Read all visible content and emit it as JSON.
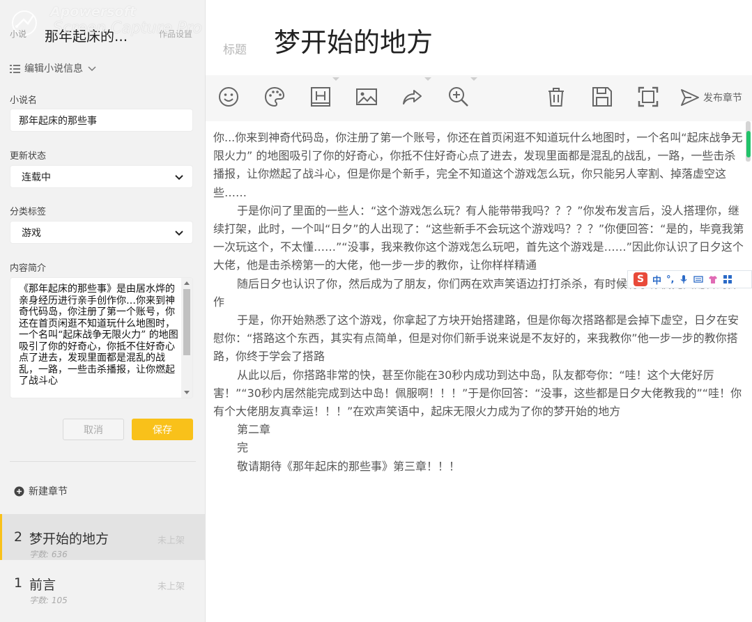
{
  "watermark": {
    "line1": "Apowersoft",
    "line2": "Screen Capture Pro"
  },
  "sidebar": {
    "small_label": "小说",
    "book_title": "那年起床的...",
    "header_right": "作品设置",
    "edit_info_label": "编辑小说信息",
    "novel_name_label": "小说名",
    "novel_name_value": "那年起床的那些事",
    "status_label": "更新状态",
    "status_value": "连载中",
    "category_label": "分类标签",
    "category_value": "游戏",
    "summary_label": "内容简介",
    "summary_value": "《那年起床的那些事》是由居水烨的亲身经历进行亲手创作你…你来到神奇代码岛，你注册了第一个账号，你还在首页闲逛不知道玩什么地图时，一个名叫“起床战争无限火力” 的地图吸引了你的好奇心，你抵不住好奇心点了进去，发现里面都是混乱的战乱，一路，一些击杀播报，让你燃起了战斗心",
    "cancel_label": "取消",
    "save_label": "保存",
    "new_chapter_label": "新建章节",
    "chapters": [
      {
        "num": "2",
        "title": "梦开始的地方",
        "count": "字数: 636",
        "status": "未上架"
      },
      {
        "num": "1",
        "title": "前言",
        "count": "字数: 105",
        "status": "未上架"
      }
    ]
  },
  "editor": {
    "title_label": "标题",
    "title_value": "梦开始的地方",
    "toolbar": {
      "icons": [
        "emoji-icon",
        "palette-icon",
        "heading-icon",
        "image-icon",
        "share-icon",
        "zoom-in-icon",
        "trash-icon",
        "save-icon",
        "fullscreen-icon"
      ],
      "publish_label": "发布章节"
    },
    "paragraphs": [
      "你...你来到神奇代码岛，你注册了第一个账号，你还在首页闲逛不知道玩什么地图时，一个名叫“起床战争无限火力” 的地图吸引了你的好奇心，你抵不住好奇心点了进去，发现里面都是混乱的战乱，一路，一些击杀播报，让你燃起了战斗心，但是你是个新手，完全不知道这个游戏怎么玩，你只能另人宰割、掉落虚空这些……",
      "于是你问了里面的一些人：“这个游戏怎么玩？有人能带带我吗？？？”你发布发言后，没人搭理你，继续打架，此时，一个叫“日夕”的人出现了：“这些新手不会玩这个游戏吗？？？”你便回答：“是的，毕竟我第一次玩这个，不太懂……”“没事，我来教你这个游戏怎么玩吧，首先这个游戏是……”因此你认识了日夕这个大佬，他是击杀榜第一的大佬，他一步一步的教你，让你样样精通",
      "随后日夕也认识了你，然后成为了朋友，你们两在欢声笑语边打打杀杀，有时候有了你俩完美配合的操作",
      "于是，你开始熟悉了这个游戏，你拿起了方块开始搭建路，但是你每次搭路都是会掉下虚空，日夕在安慰你：“搭路这个东西，其实有点简单，但是对你们新手说来说是不友好的，来我教你”他一步一步的教你搭路，你终于学会了搭路",
      "从此以后，你搭路非常的快，甚至你能在30秒内成功到达中岛，队友都夸你：“哇！这个大佬好厉害！”“30秒内居然能完成到达中岛！佩服啊！！！”于是你回答：“没事，这些都是日夕大佬教我的”“哇！你有个大佬朋友真幸运！！！”在欢声笑语中，起床无限火力成为了你的梦开始的地方",
      "第二章",
      "完",
      "敬请期待《那年起床的那些事》第三章！！！"
    ]
  },
  "ime": {
    "logo": "S",
    "mode": "中",
    "punct": "°,"
  }
}
